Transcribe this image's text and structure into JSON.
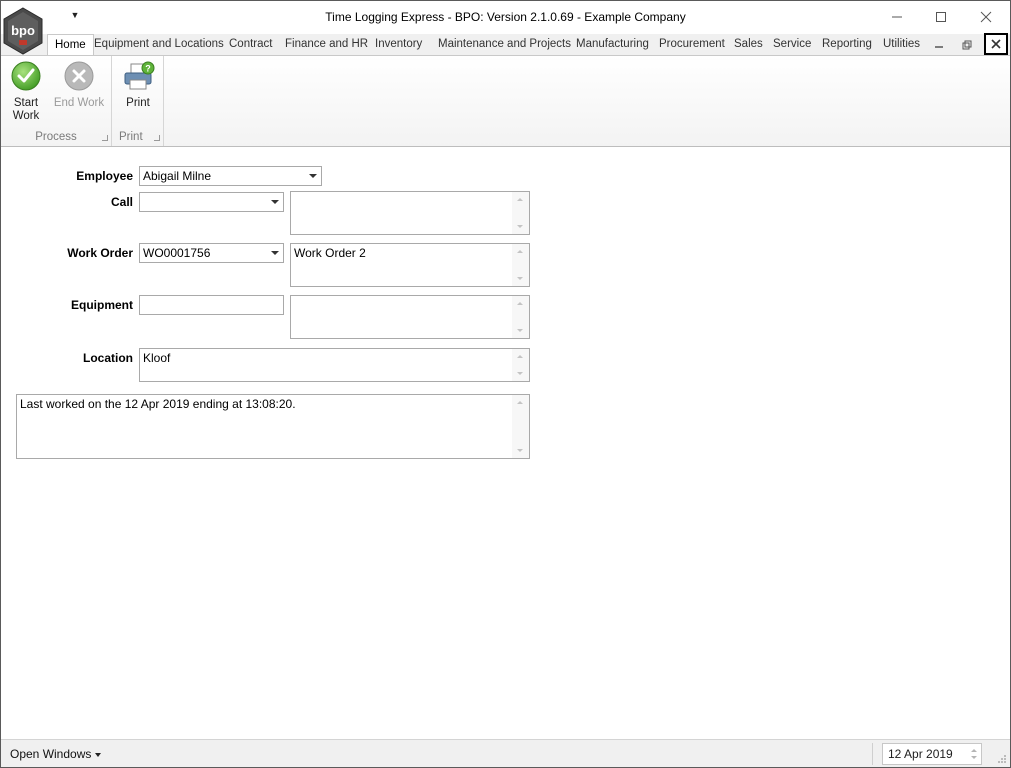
{
  "window": {
    "title": "Time Logging Express - BPO: Version 2.1.0.69 - Example Company",
    "logo_text": "bpo"
  },
  "tabs": [
    {
      "label": "Home",
      "active": true
    },
    {
      "label": "Equipment and Locations"
    },
    {
      "label": "Contract"
    },
    {
      "label": "Finance and HR"
    },
    {
      "label": "Inventory"
    },
    {
      "label": "Maintenance and Projects"
    },
    {
      "label": "Manufacturing"
    },
    {
      "label": "Procurement"
    },
    {
      "label": "Sales"
    },
    {
      "label": "Service"
    },
    {
      "label": "Reporting"
    },
    {
      "label": "Utilities"
    }
  ],
  "ribbon": {
    "process": {
      "group_label": "Process",
      "start_work": {
        "line1": "Start",
        "line2": "Work",
        "icon": "checkmark-icon"
      },
      "end_work": {
        "label": "End Work",
        "icon": "cancel-icon"
      }
    },
    "print": {
      "group_label": "Print",
      "print_button": {
        "label": "Print",
        "icon": "printer-icon"
      }
    }
  },
  "form": {
    "employee": {
      "label": "Employee",
      "value": "Abigail Milne"
    },
    "call": {
      "label": "Call",
      "value": "",
      "description": ""
    },
    "work_order": {
      "label": "Work Order",
      "value": "WO0001756",
      "description": "Work Order 2"
    },
    "equipment": {
      "label": "Equipment",
      "value": "",
      "description": ""
    },
    "location": {
      "label": "Location",
      "value": "Kloof"
    },
    "status_message": "Last worked on the 12 Apr 2019 ending at 13:08:20."
  },
  "statusbar": {
    "open_windows": "Open Windows",
    "date": "12 Apr 2019"
  },
  "colors": {
    "accent_green": "#5fb33a",
    "ribbon_bg": "#f3f3f3",
    "border": "#a9a9a9"
  }
}
